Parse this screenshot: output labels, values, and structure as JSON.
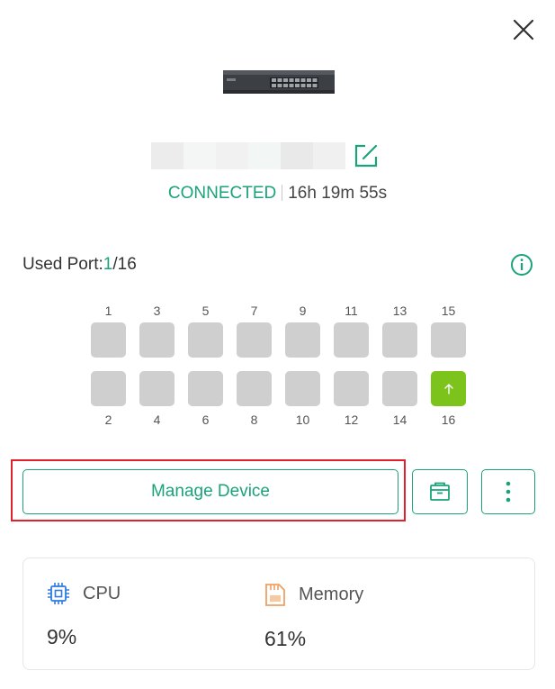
{
  "device": {
    "status": "CONNECTED",
    "uptime": "16h 19m 55s"
  },
  "ports": {
    "label": "Used Port:",
    "used": "1",
    "total_text": "/16",
    "items": [
      {
        "number": "1",
        "active": false
      },
      {
        "number": "2",
        "active": false
      },
      {
        "number": "3",
        "active": false
      },
      {
        "number": "4",
        "active": false
      },
      {
        "number": "5",
        "active": false
      },
      {
        "number": "6",
        "active": false
      },
      {
        "number": "7",
        "active": false
      },
      {
        "number": "8",
        "active": false
      },
      {
        "number": "9",
        "active": false
      },
      {
        "number": "10",
        "active": false
      },
      {
        "number": "11",
        "active": false
      },
      {
        "number": "12",
        "active": false
      },
      {
        "number": "13",
        "active": false
      },
      {
        "number": "14",
        "active": false
      },
      {
        "number": "15",
        "active": false
      },
      {
        "number": "16",
        "active": true,
        "icon": "uplink-arrow-icon"
      }
    ]
  },
  "actions": {
    "manage_label": "Manage Device",
    "icons": [
      "close-icon",
      "edit-icon",
      "info-icon",
      "box-icon",
      "more-vertical-icon"
    ]
  },
  "stats": {
    "cpu_label": "CPU",
    "cpu_value": "9%",
    "memory_label": "Memory",
    "memory_value": "61%"
  },
  "colors": {
    "accent": "#1aa37a",
    "port_active": "#7cc31b",
    "port_idle": "#cfcfcf",
    "highlight_border": "#e0202a",
    "memory_icon": "#f0a060",
    "cpu_icon": "#2f7be0"
  }
}
